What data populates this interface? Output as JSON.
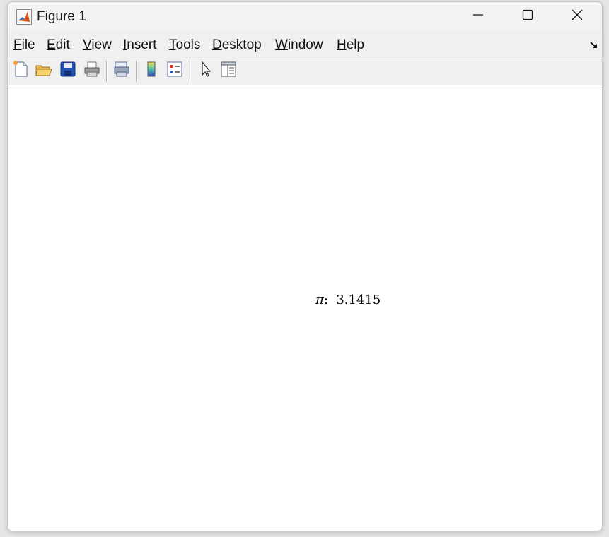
{
  "window": {
    "title": "Figure 1"
  },
  "menu": {
    "file": {
      "accel": "F",
      "rest": "ile"
    },
    "edit": {
      "accel": "E",
      "rest": "dit"
    },
    "view": {
      "accel": "V",
      "rest": "iew"
    },
    "insert": {
      "accel": "I",
      "rest": "nsert"
    },
    "tools": {
      "accel": "T",
      "rest": "ools"
    },
    "desktop": {
      "accel": "D",
      "rest": "esktop"
    },
    "window": {
      "accel": "W",
      "rest": "indow"
    },
    "help": {
      "accel": "H",
      "rest": "elp"
    }
  },
  "toolbar": {
    "icons": [
      "new-figure-icon",
      "open-file-icon",
      "save-icon",
      "print-icon",
      "link-plot-icon",
      "colorbar-icon",
      "legend-icon",
      "edit-plot-arrow-icon",
      "property-inspector-icon"
    ]
  },
  "figure": {
    "symbol": "π",
    "separator": ":  ",
    "value": "3.1415"
  },
  "colors": {
    "matlab_orange": "#d9541a",
    "save_blue": "#1f4fb0",
    "figure_bg": "#ffffff"
  }
}
